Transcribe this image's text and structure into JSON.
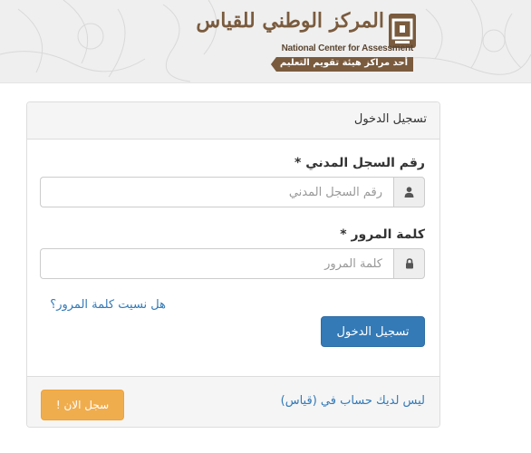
{
  "header": {
    "logo": {
      "arabic_name": "المركز الوطني للقياس",
      "english_name": "National Center for Assessment",
      "tagline": "أحد مراكز هيئة تقويم التعليم",
      "brand_color": "#7a5b3e"
    }
  },
  "login_panel": {
    "title": "تسجيل الدخول",
    "civil_id": {
      "label": "رقم السجل المدني *",
      "placeholder": "رقم السجل المدني",
      "value": "",
      "icon": "user-icon"
    },
    "password": {
      "label": "كلمة المرور *",
      "placeholder": "كلمة المرور",
      "value": "",
      "icon": "lock-icon"
    },
    "forgot_password_link": "هل نسيت كلمة المرور؟",
    "login_button": "تسجيل الدخول",
    "footer": {
      "no_account_text": "ليس لديك حساب في (قياس)",
      "register_button": "سجل الان !"
    }
  },
  "colors": {
    "primary": "#337ab7",
    "warning": "#f0ad4e",
    "panel_bg": "#f5f5f5"
  }
}
